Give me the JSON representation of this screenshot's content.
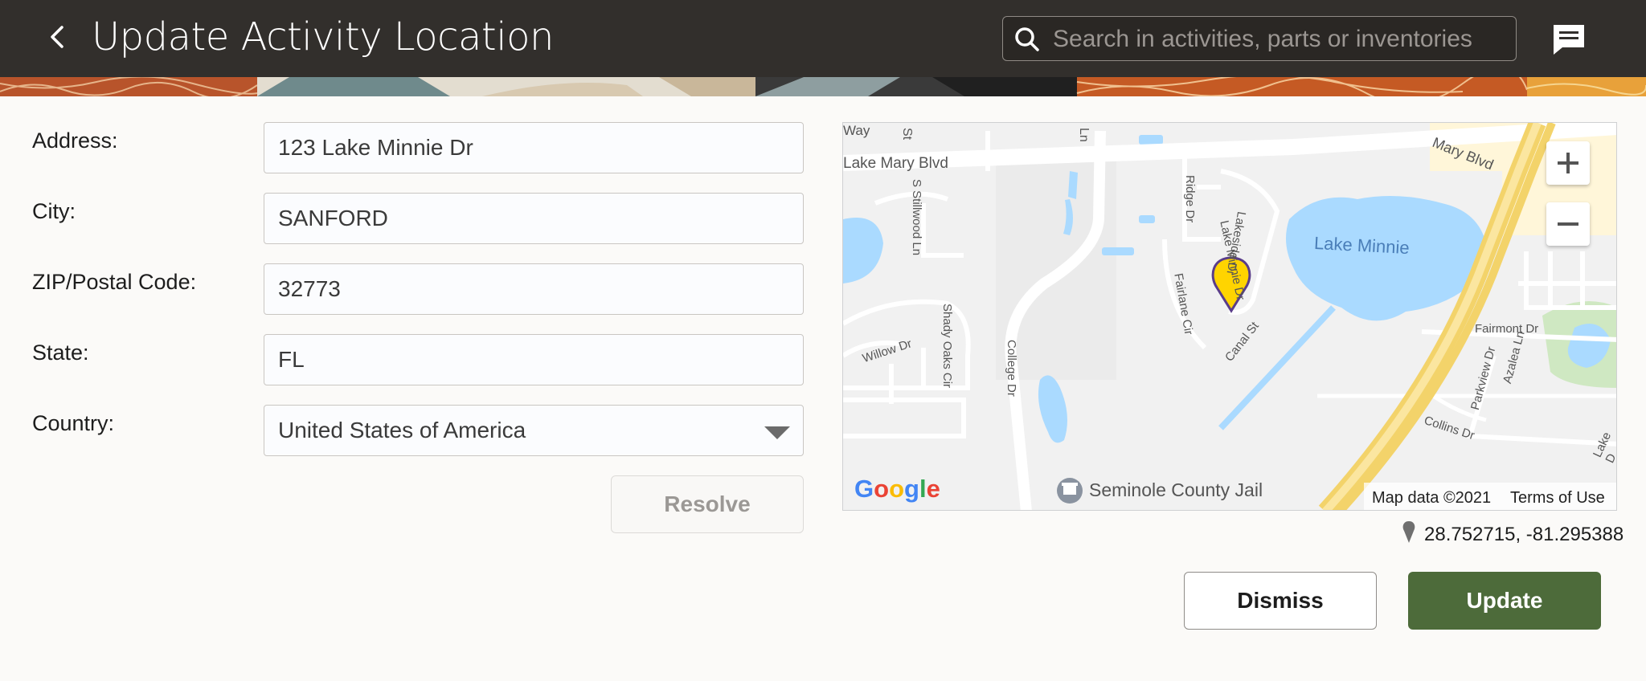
{
  "header": {
    "title": "Update Activity Location",
    "search_placeholder": "Search in activities, parts or inventories"
  },
  "form": {
    "address_label": "Address:",
    "address_value": "123 Lake Minnie Dr",
    "city_label": "City:",
    "city_value": "SANFORD",
    "zip_label": "ZIP/Postal Code:",
    "zip_value": "32773",
    "state_label": "State:",
    "state_value": "FL",
    "country_label": "Country:",
    "country_value": "United States of America",
    "resolve_label": "Resolve"
  },
  "map": {
    "labels": {
      "way": "Way",
      "lake_mary_blvd": "Lake Mary Blvd",
      "lake_mary_blvd_2": "Mary Blvd",
      "st": "St",
      "ln": "Ln",
      "stillwood": "S Stillwood Ln",
      "ridge": "Ridge Dr",
      "lake_minnie_dr": "Lake Minnie Dr",
      "lakeside": "Lakeside Dr",
      "lake_minnie": "Lake Minnie",
      "fairlane": "Fairlane Cir",
      "canal": "Canal St",
      "willow": "Willow Dr",
      "shady_oaks": "Shady Oaks Cir",
      "college": "College Dr",
      "fairmont": "Fairmont Dr",
      "parkview": "Parkview Dr",
      "azalea": "Azalea Ln",
      "collins": "Collins Dr",
      "lake_dr": "Lake D",
      "jail": "Seminole County Jail"
    },
    "brand": "Google",
    "map_data": "Map data ©2021",
    "terms": "Terms of Use",
    "coordinates": "28.752715, -81.295388"
  },
  "actions": {
    "dismiss_label": "Dismiss",
    "update_label": "Update"
  },
  "colors": {
    "header_bg": "#322f2c",
    "update_bg": "#4d6b3a",
    "pin": "#ffd400",
    "water": "#aadaff",
    "highway": "#f8e27a"
  }
}
